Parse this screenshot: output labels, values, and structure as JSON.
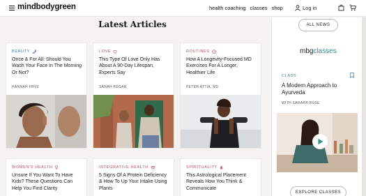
{
  "header": {
    "brand": "mindbodygreen",
    "nav": [
      "health coaching",
      "classes",
      "shop"
    ],
    "login": "Log in"
  },
  "main": {
    "section_title": "Latest Articles",
    "articles": [
      {
        "category": "BEAUTY",
        "title": "Once & For All: Should You Wash Your Face In The Morning Or Not?",
        "author": "HANNAH FRYE"
      },
      {
        "category": "LOVE",
        "title": "This Type Of Love Only Has About A 90-Day Lifespan, Experts Say",
        "author": "SARAH REGAN"
      },
      {
        "category": "ROUTINES",
        "title": "How A Longevity-Focused MD Exercises For A Longer, Healthier Life",
        "author": "PETER ATTIA, MD"
      },
      {
        "category": "WOMEN'S HEALTH",
        "title": "Unsure If You Want To Have Kids? These Questions Can Help You Find Clarity",
        "author": ""
      },
      {
        "category": "INTEGRATIVE HEALTH",
        "title": "5 Signs Of A Protein Deficiency & How To Up Your Intake Using Plants",
        "author": ""
      },
      {
        "category": "SPIRITUALITY",
        "title": "This Astrological Placement Reveals How You Think & Communicate",
        "author": ""
      }
    ]
  },
  "sidebar": {
    "all_news": "ALL NEWS",
    "logo_mbg": "mbg",
    "logo_classes": "classes",
    "class_label": "CLASS",
    "class_title": "A Modern Approach to Ayurveda",
    "class_by": "WITH SAHARA ROSE",
    "explore": "EXPLORE CLASSES"
  },
  "colors": {
    "pink": "#c0485b",
    "blue": "#3b6fb6",
    "teal": "#2f8f86"
  },
  "icons": [
    "menu-icon",
    "user-icon",
    "bag-icon",
    "cart-icon",
    "lipstick-icon",
    "heart-icon",
    "clock-icon",
    "venus-icon",
    "heart-pulse-icon",
    "flame-icon",
    "bookmark-icon",
    "play-icon"
  ]
}
